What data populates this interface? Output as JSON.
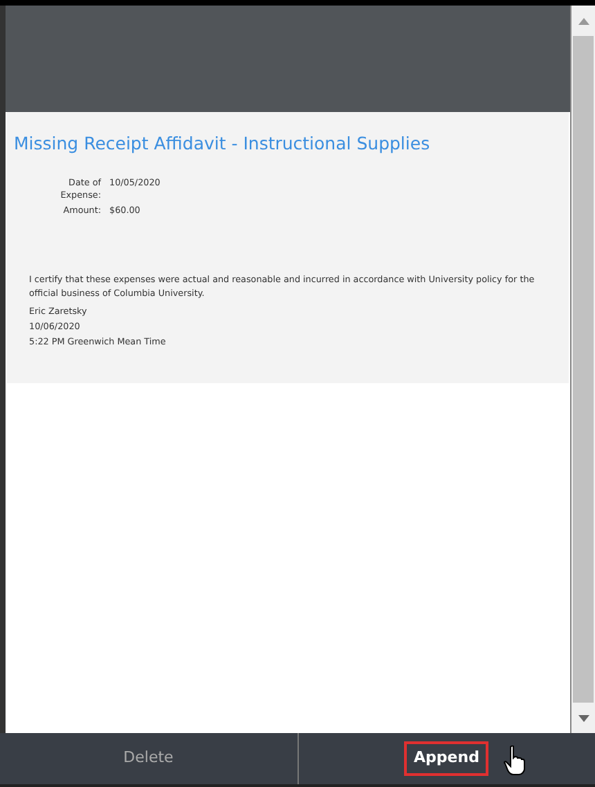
{
  "document": {
    "title": "Missing Receipt Affidavit - Instructional Supplies",
    "fields": [
      {
        "label": "Date of Expense:",
        "value": "10/05/2020"
      },
      {
        "label": "Amount:",
        "value": "$60.00"
      }
    ],
    "certification": "I certify that these expenses were actual and reasonable and incurred in accordance with University policy for the official business of Columbia University.",
    "signature": [
      "Eric Zaretsky",
      "10/06/2020",
      "5:22 PM Greenwich Mean Time"
    ]
  },
  "buttons": [
    {
      "label": "Delete",
      "disabled": true,
      "highlighted": false
    },
    {
      "label": "Append",
      "disabled": false,
      "highlighted": true
    }
  ]
}
